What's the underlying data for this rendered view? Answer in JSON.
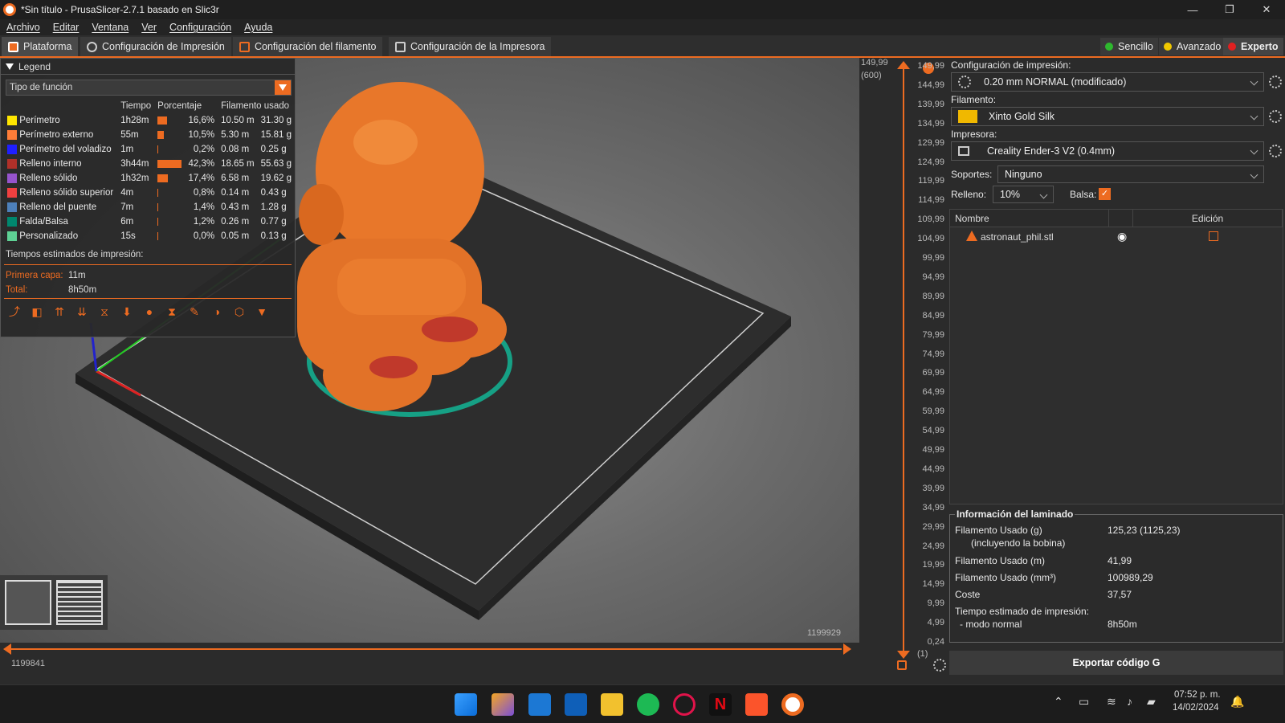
{
  "window": {
    "title": "*Sin título - PrusaSlicer-2.7.1 basado en Slic3r",
    "minimize": "—",
    "restore": "❐",
    "close": "✕"
  },
  "menu": [
    "Archivo",
    "Editar",
    "Ventana",
    "Ver",
    "Configuración",
    "Ayuda"
  ],
  "tabs": [
    "Plataforma",
    "Configuración de Impresión",
    "Configuración del filamento",
    "Configuración de la Impresora"
  ],
  "modes": [
    {
      "label": "Sencillo",
      "color": "#2eb82e"
    },
    {
      "label": "Avanzado",
      "color": "#f0c800"
    },
    {
      "label": "Experto",
      "color": "#e02020"
    }
  ],
  "legend": {
    "title": "Legend",
    "combo": "Tipo de función",
    "headers": {
      "time": "Tiempo",
      "pct": "Porcentaje",
      "filament": "Filamento usado"
    },
    "rows": [
      {
        "name": "Perímetro",
        "color": "#ffe600",
        "time": "1h28m",
        "pct": "16,6%",
        "pct_value": 16.6,
        "m": "10.50 m",
        "g": "31.30 g"
      },
      {
        "name": "Perímetro externo",
        "color": "#ff7d38",
        "time": "55m",
        "pct": "10,5%",
        "pct_value": 10.5,
        "m": "5.30 m",
        "g": "15.81 g"
      },
      {
        "name": "Perímetro del voladizo",
        "color": "#1f1fff",
        "time": "1m",
        "pct": "0,2%",
        "pct_value": 0.2,
        "m": "0.08 m",
        "g": "0.25 g"
      },
      {
        "name": "Relleno interno",
        "color": "#b03029",
        "time": "3h44m",
        "pct": "42,3%",
        "pct_value": 42.3,
        "m": "18.65 m",
        "g": "55.63 g"
      },
      {
        "name": "Relleno sólido",
        "color": "#9654cc",
        "time": "1h32m",
        "pct": "17,4%",
        "pct_value": 17.4,
        "m": "6.58 m",
        "g": "19.62 g"
      },
      {
        "name": "Relleno sólido superior",
        "color": "#f04040",
        "time": "4m",
        "pct": "0,8%",
        "pct_value": 0.8,
        "m": "0.14 m",
        "g": "0.43 g"
      },
      {
        "name": "Relleno del puente",
        "color": "#4d80ba",
        "time": "7m",
        "pct": "1,4%",
        "pct_value": 1.4,
        "m": "0.43 m",
        "g": "1.28 g"
      },
      {
        "name": "Falda/Balsa",
        "color": "#00876e",
        "time": "6m",
        "pct": "1,2%",
        "pct_value": 1.2,
        "m": "0.26 m",
        "g": "0.77 g"
      },
      {
        "name": "Personalizado",
        "color": "#5ed194",
        "time": "15s",
        "pct": "0,0%",
        "pct_value": 0.0,
        "m": "0.05 m",
        "g": "0.13 g"
      }
    ],
    "times_title": "Tiempos estimados de impresión:",
    "first_layer_label": "Primera capa:",
    "first_layer": "11m",
    "total_label": "Total:",
    "total": "8h50m"
  },
  "vslider": {
    "top_value": "149,99",
    "top_layer": "(600)",
    "ticks": [
      "149,99",
      "144,99",
      "139,99",
      "134,99",
      "129,99",
      "124,99",
      "119,99",
      "114,99",
      "109,99",
      "104,99",
      "99,99",
      "94,99",
      "89,99",
      "84,99",
      "79,99",
      "74,99",
      "69,99",
      "64,99",
      "59,99",
      "54,99",
      "49,99",
      "44,99",
      "39,99",
      "34,99",
      "29,99",
      "24,99",
      "19,99",
      "14,99",
      "9,99",
      "4,99",
      "0,24"
    ],
    "bottom_layer": "(1)"
  },
  "hslider": {
    "left": "1199841",
    "right": "1199929"
  },
  "right_panel": {
    "print_label": "Configuración de impresión:",
    "print_value": "0.20 mm NORMAL (modificado)",
    "filament_label": "Filamento:",
    "filament_value": "Xinto Gold Silk",
    "filament_color": "#f0b800",
    "printer_label": "Impresora:",
    "printer_value": "Creality Ender-3 V2 (0.4mm)",
    "supports_label": "Soportes:",
    "supports_value": "Ninguno",
    "infill_label": "Relleno:",
    "infill_value": "10%",
    "brim_label": "Balsa:",
    "list_headers": {
      "name": "Nombre",
      "edit": "Edición"
    },
    "objects": [
      {
        "name": "astronaut_phil.stl"
      }
    ],
    "info_title": "Información del laminado",
    "info_rows": [
      {
        "k": "Filamento Usado (g)",
        "k2": "(incluyendo la bobina)",
        "v": "125,23 (1125,23)"
      },
      {
        "k": "Filamento Usado (m)",
        "v": "41,99"
      },
      {
        "k": "Filamento Usado (mm³)",
        "v": "100989,29"
      },
      {
        "k": "Coste",
        "v": "37,57"
      },
      {
        "k": "Tiempo estimado de impresión:",
        "k2": "- modo normal",
        "v": "8h50m"
      }
    ],
    "export_label": "Exportar código G"
  },
  "taskbar": {
    "time": "07:52 p. m.",
    "date": "14/02/2024"
  }
}
